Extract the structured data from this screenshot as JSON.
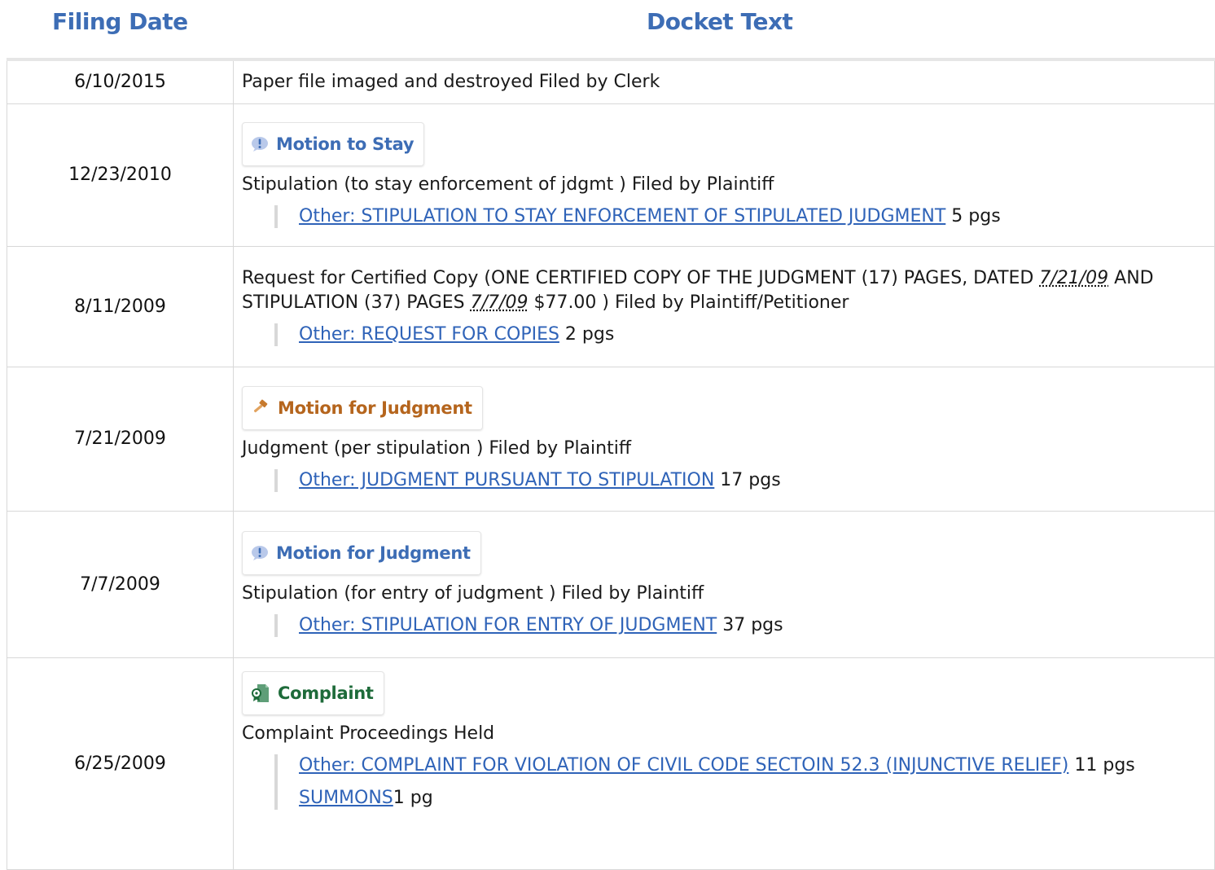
{
  "header": {
    "filing_date": "Filing Date",
    "docket_text": "Docket Text"
  },
  "colors": {
    "accent": "#3d6db5",
    "link": "#2f63b8",
    "judgment_badge": "#b5651d",
    "complaint_badge": "#1e6b3a"
  },
  "entries": [
    {
      "date": "6/10/2015",
      "text": "Paper file imaged and destroyed Filed by Clerk"
    },
    {
      "date": "12/23/2010",
      "badge": {
        "label": "Motion to Stay",
        "icon": "exclamation-bubble-icon"
      },
      "text": "Stipulation (to stay enforcement of jdgmt ) Filed by Plaintiff",
      "doc": {
        "link": "Other: STIPULATION TO STAY ENFORCEMENT OF STIPULATED JUDGMENT",
        "pages": " 5 pgs"
      }
    },
    {
      "date": "8/11/2009",
      "text_parts": {
        "a": "Request for Certified Copy (ONE CERTIFIED COPY OF THE JUDGMENT (17) PAGES, DATED ",
        "d1": "7/21/09",
        "b": " AND STIPULATION (37) PAGES ",
        "d2": "7/7/09",
        "c": " $77.00 ) Filed by Plaintiff/Petitioner"
      },
      "doc": {
        "link": "Other: REQUEST FOR COPIES",
        "pages": " 2 pgs"
      }
    },
    {
      "date": "7/21/2009",
      "badge": {
        "label": "Motion for Judgment",
        "icon": "gavel-icon"
      },
      "text": "Judgment (per stipulation ) Filed by Plaintiff",
      "doc": {
        "link": "Other: JUDGMENT PURSUANT TO STIPULATION",
        "pages": " 17 pgs"
      }
    },
    {
      "date": "7/7/2009",
      "badge": {
        "label": "Motion for Judgment",
        "icon": "exclamation-bubble-icon"
      },
      "text": "Stipulation (for entry of judgment ) Filed by Plaintiff",
      "doc": {
        "link": "Other: STIPULATION FOR ENTRY OF JUDGMENT",
        "pages": " 37 pgs"
      }
    },
    {
      "date": "6/25/2009",
      "badge": {
        "label": "Complaint",
        "icon": "complaint-document-icon"
      },
      "text": "Complaint Proceedings Held",
      "doc": {
        "link": "Other: COMPLAINT FOR VIOLATION OF CIVIL CODE SECTOIN 52.3 (INJUNCTIVE RELIEF)",
        "pages": " 11 pgs"
      },
      "doc2": {
        "link": "SUMMONS",
        "pages": "1 pg"
      }
    }
  ]
}
